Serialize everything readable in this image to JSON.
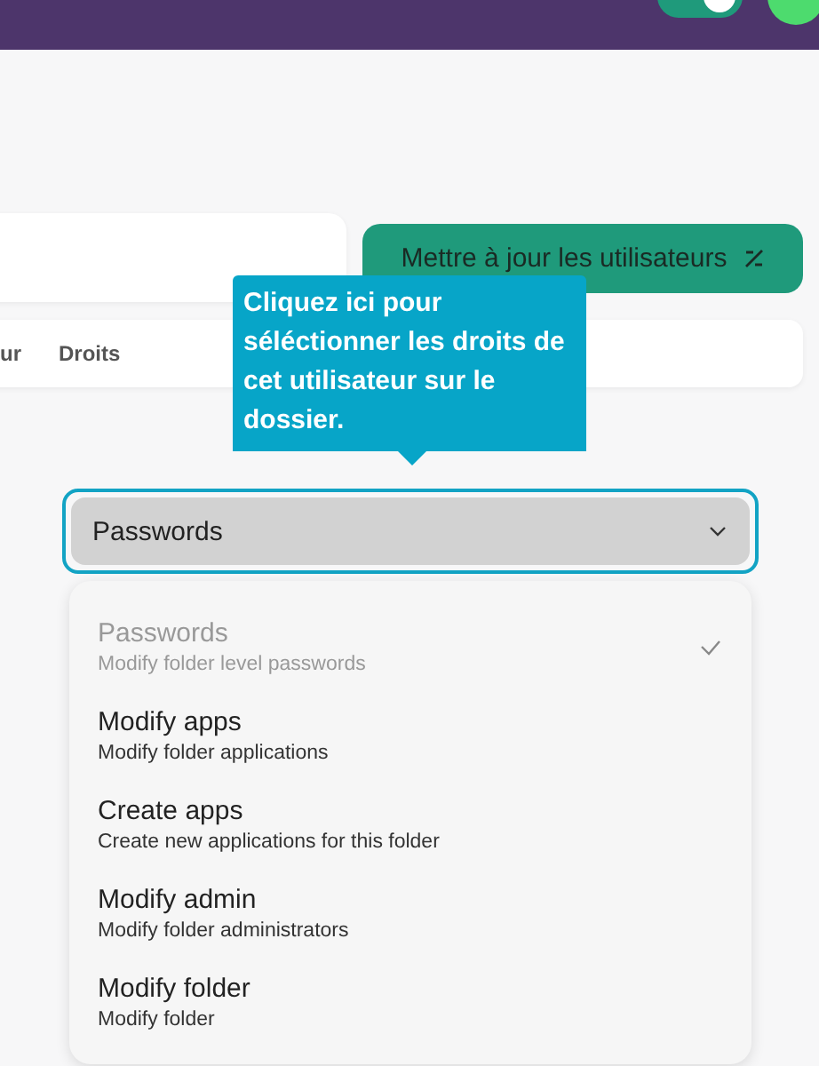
{
  "header": {
    "toggle": {
      "on": true
    }
  },
  "toolbar": {
    "update_button": "Mettre à jour les utilisateurs"
  },
  "table": {
    "columns": [
      "ur",
      "Droits"
    ]
  },
  "tooltip": {
    "text": "Cliquez ici pour séléctionner les droits de cet utilisateur sur le dossier."
  },
  "select": {
    "value": "Passwords",
    "focused": true
  },
  "options": [
    {
      "title": "Passwords",
      "description": "Modify folder level passwords",
      "selected": true
    },
    {
      "title": "Modify apps",
      "description": "Modify folder applications",
      "selected": false
    },
    {
      "title": "Create apps",
      "description": "Create new applications for this folder",
      "selected": false
    },
    {
      "title": "Modify admin",
      "description": "Modify folder administrators",
      "selected": false
    },
    {
      "title": "Modify folder",
      "description": "Modify folder",
      "selected": false
    }
  ]
}
